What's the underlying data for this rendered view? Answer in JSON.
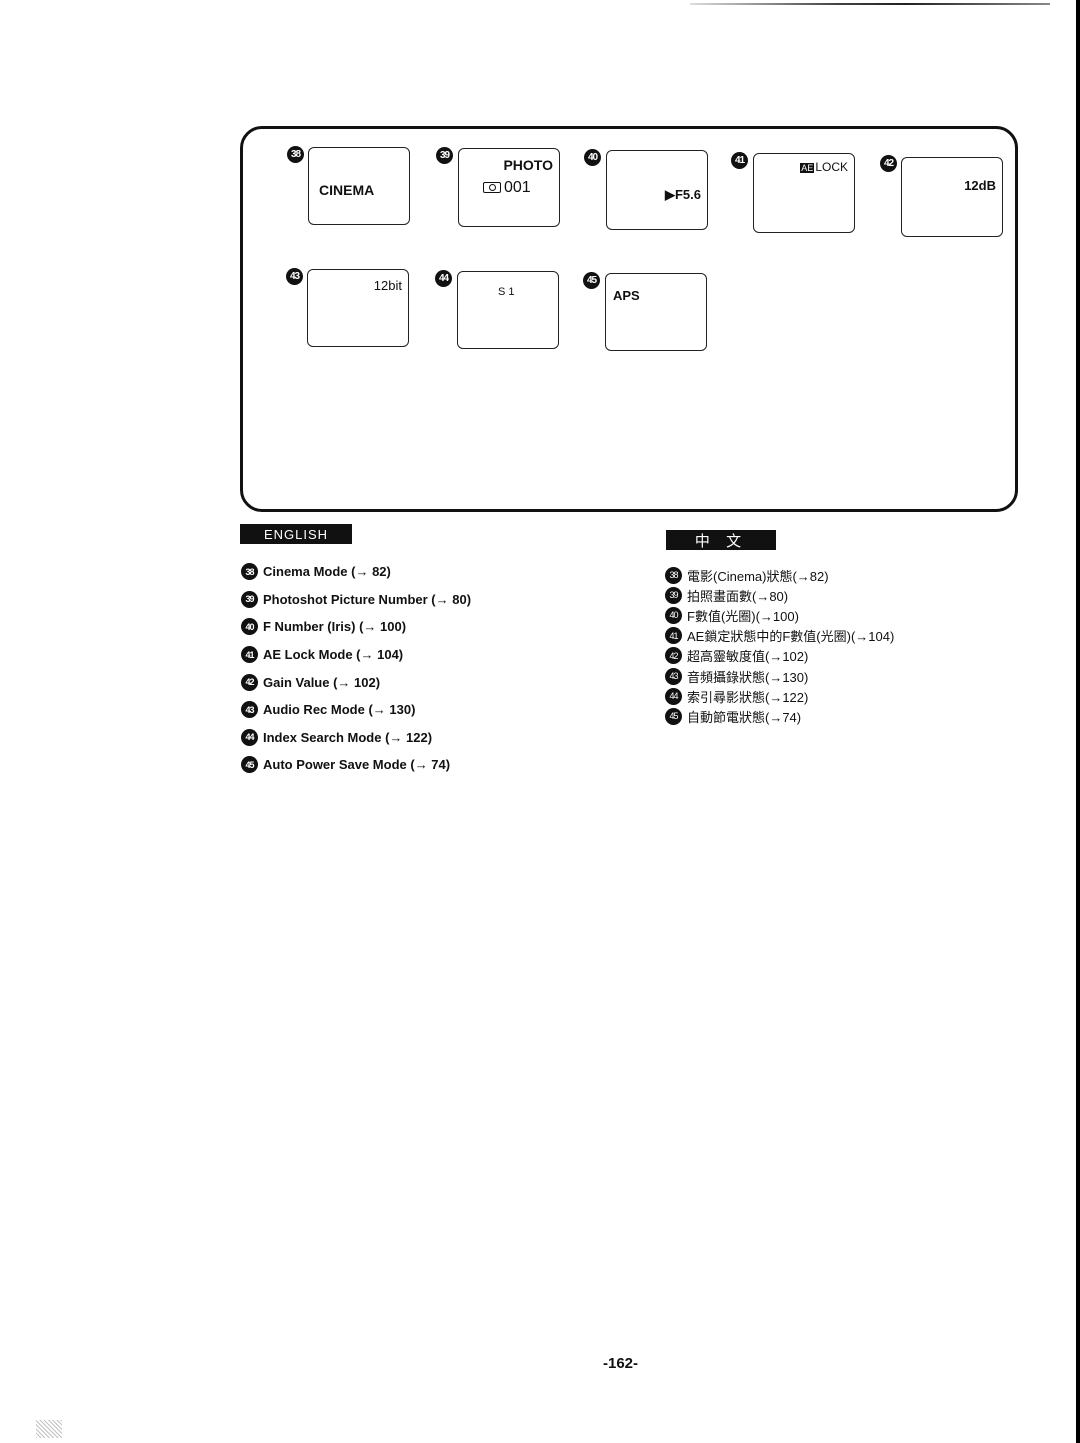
{
  "page_number": "-162-",
  "diagram": {
    "screens": [
      {
        "num": "38",
        "lines": [
          "CINEMA"
        ]
      },
      {
        "num": "39",
        "lines": [
          "PHOTO",
          "001"
        ],
        "icon": "camera-icon"
      },
      {
        "num": "40",
        "lines": [
          "F5.6"
        ],
        "icon": "play-triangle-icon"
      },
      {
        "num": "41",
        "lines": [
          "LOCK"
        ],
        "badge_text": "AE"
      },
      {
        "num": "42",
        "lines": [
          "12dB"
        ]
      },
      {
        "num": "43",
        "lines": [
          "12bit"
        ]
      },
      {
        "num": "44",
        "lines": [
          "S 1"
        ]
      },
      {
        "num": "45",
        "lines": [
          "APS"
        ]
      }
    ]
  },
  "english": {
    "header": "ENGLISH",
    "items": [
      {
        "num": "38",
        "text": "Cinema Mode (→ 82)"
      },
      {
        "num": "39",
        "text": "Photoshot Picture Number (→ 80)"
      },
      {
        "num": "40",
        "text": "F Number (Iris) (→ 100)"
      },
      {
        "num": "41",
        "text": "AE Lock Mode (→ 104)"
      },
      {
        "num": "42",
        "text": "Gain Value (→ 102)"
      },
      {
        "num": "43",
        "text": "Audio Rec Mode (→ 130)"
      },
      {
        "num": "44",
        "text": "Index Search Mode (→ 122)"
      },
      {
        "num": "45",
        "text": "Auto Power Save Mode (→ 74)"
      }
    ]
  },
  "chinese": {
    "header": "中 文",
    "items": [
      {
        "num": "38",
        "text": "電影(Cinema)狀態(→82)"
      },
      {
        "num": "39",
        "text": "拍照畫面數(→80)"
      },
      {
        "num": "40",
        "text": "F數值(光圈)(→100)"
      },
      {
        "num": "41",
        "text": "AE鎖定狀態中的F數值(光圈)(→104)"
      },
      {
        "num": "42",
        "text": "超高靈敏度值(→102)"
      },
      {
        "num": "43",
        "text": "音頻攝錄狀態(→130)"
      },
      {
        "num": "44",
        "text": "索引尋影狀態(→122)"
      },
      {
        "num": "45",
        "text": "自動節電狀態(→74)"
      }
    ]
  }
}
